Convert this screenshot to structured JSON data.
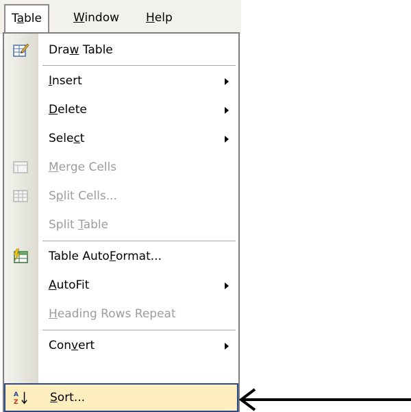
{
  "menubar": {
    "items": [
      {
        "pre": "T",
        "u": "a",
        "post": "ble"
      },
      {
        "pre": "",
        "u": "W",
        "post": "indow"
      },
      {
        "pre": "",
        "u": "H",
        "post": "elp"
      }
    ]
  },
  "menu": {
    "items": [
      {
        "pre": "Dra",
        "u": "w",
        "post": " Table",
        "icon": "draw-table-icon",
        "enabled": true
      },
      {
        "pre": "",
        "u": "I",
        "post": "nsert",
        "submenu": true,
        "enabled": true
      },
      {
        "pre": "",
        "u": "D",
        "post": "elete",
        "submenu": true,
        "enabled": true
      },
      {
        "pre": "Sele",
        "u": "c",
        "post": "t",
        "submenu": true,
        "enabled": true
      },
      {
        "pre": "",
        "u": "M",
        "post": "erge Cells",
        "icon": "merge-cells-icon",
        "enabled": false
      },
      {
        "pre": "S",
        "u": "p",
        "post": "lit Cells...",
        "icon": "split-cells-icon",
        "enabled": false
      },
      {
        "pre": "Split ",
        "u": "T",
        "post": "able",
        "enabled": false
      },
      {
        "pre": "Table Auto",
        "u": "F",
        "post": "ormat...",
        "icon": "table-autoformat-icon",
        "enabled": true
      },
      {
        "pre": "",
        "u": "A",
        "post": "utoFit",
        "submenu": true,
        "enabled": true
      },
      {
        "pre": "",
        "u": "H",
        "post": "eading Rows Repeat",
        "enabled": false
      },
      {
        "pre": "Con",
        "u": "v",
        "post": "ert",
        "submenu": true,
        "enabled": true
      },
      {
        "pre": "",
        "u": "S",
        "post": "ort...",
        "icon": "sort-az-icon",
        "enabled": true,
        "highlighted": true
      }
    ]
  },
  "colors": {
    "highlight_fill": "#ffeebe",
    "highlight_border": "#2c4a8a",
    "disabled_text": "#9c9c9c"
  }
}
